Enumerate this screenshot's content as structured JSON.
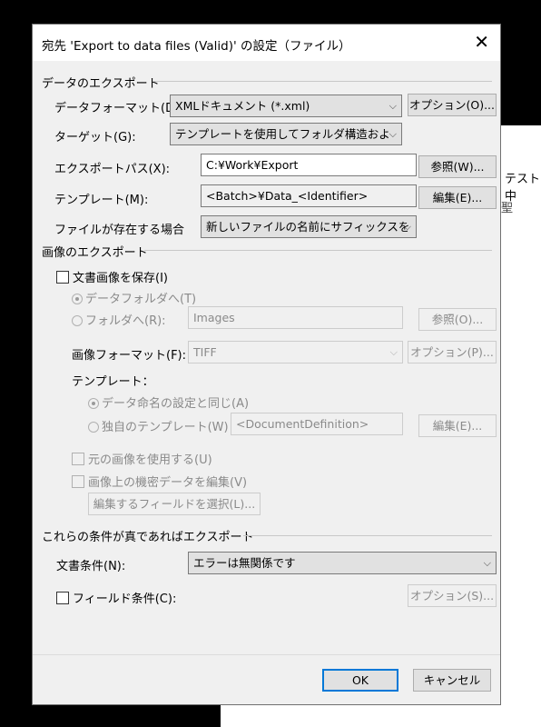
{
  "background": {
    "snippet_1": "テスト中",
    "snippet_2": "聖"
  },
  "dialog": {
    "title": "宛先 'Export to data files (Valid)' の設定（ファイル）",
    "close_label": "✕"
  },
  "data_export": {
    "heading": "データのエクスポート",
    "format_label": "データフォーマット(D):",
    "format_value": "XMLドキュメント (*.xml)",
    "options_button": "オプション(O)...",
    "target_label": "ターゲット(G):",
    "target_value": "テンプレートを使用してフォルダ構造およ",
    "path_label": "エクスポートパス(X):",
    "path_value": "C:¥Work¥Export",
    "browse_button": "参照(W)...",
    "template_label": "テンプレート(M):",
    "template_value": "<Batch>¥Data_<Identifier>",
    "edit_button": "編集(E)...",
    "exists_label": "ファイルが存在する場合",
    "exists_value": "新しいファイルの名前にサフィックスを"
  },
  "image_export": {
    "heading": "画像のエクスポート",
    "save_images_label": "文書画像を保存(I)",
    "to_data_folder_label": "データフォルダへ(T)",
    "to_folder_label": "フォルダへ(R):",
    "folder_value": "Images",
    "browse_button": "参照(O)...",
    "image_format_label": "画像フォーマット(F):",
    "image_format_value": "TIFF",
    "options_button": "オプション(P)...",
    "template_heading": "テンプレート：",
    "same_as_data_label": "データ命名の設定と同じ(A)",
    "own_template_label": "独自のテンプレート(W)",
    "own_template_value": "<DocumentDefinition>",
    "edit_button": "編集(E)...",
    "use_original_label": "元の画像を使用する(U)",
    "edit_sensitive_label": "画像上の機密データを編集(V)",
    "select_fields_button": "編集するフィールドを選択(L)..."
  },
  "conditions": {
    "heading": "これらの条件が真であればエクスポート",
    "doc_condition_label": "文書条件(N):",
    "doc_condition_value": "エラーは無関係です",
    "field_condition_label": "フィールド条件(C):",
    "options_button": "オプション(S)..."
  },
  "footer": {
    "ok": "OK",
    "cancel": "キャンセル"
  }
}
